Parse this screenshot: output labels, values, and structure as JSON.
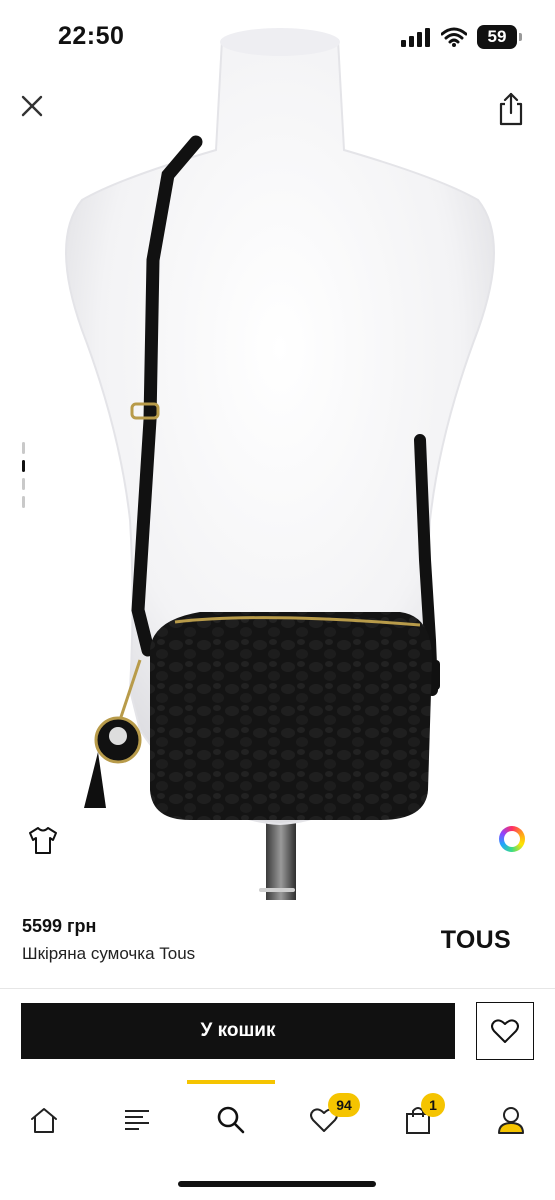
{
  "status_bar": {
    "time": "22:50",
    "battery": "59",
    "icons": [
      "cellular-signal-icon",
      "wifi-icon",
      "battery-icon"
    ]
  },
  "top_actions": {
    "close_icon": "close-icon",
    "share_icon": "share-icon"
  },
  "gallery": {
    "image_alt": "",
    "pager_count": 4,
    "pager_active": 1
  },
  "overlay_actions": {
    "tshirt_icon": "tshirt-icon",
    "color_icon": "color-wheel-icon"
  },
  "product": {
    "price": "5599 грн",
    "name": "Шкіряна сумочка Tous",
    "brand": "TOUS"
  },
  "actions": {
    "add_to_cart_label": "У кошик",
    "favorite_icon": "heart-icon"
  },
  "tabbar": {
    "active_tab": "search",
    "tabs": [
      {
        "id": "home",
        "icon": "home-icon"
      },
      {
        "id": "catalog",
        "icon": "catalog-menu-icon"
      },
      {
        "id": "search",
        "icon": "search-icon"
      },
      {
        "id": "favorites",
        "icon": "heart-icon",
        "badge": "94"
      },
      {
        "id": "cart",
        "icon": "shopping-bag-icon",
        "badge": "1"
      },
      {
        "id": "profile",
        "icon": "profile-icon"
      }
    ]
  },
  "colors": {
    "accent": "#f5c400",
    "primary": "#111111",
    "background": "#ffffff"
  }
}
